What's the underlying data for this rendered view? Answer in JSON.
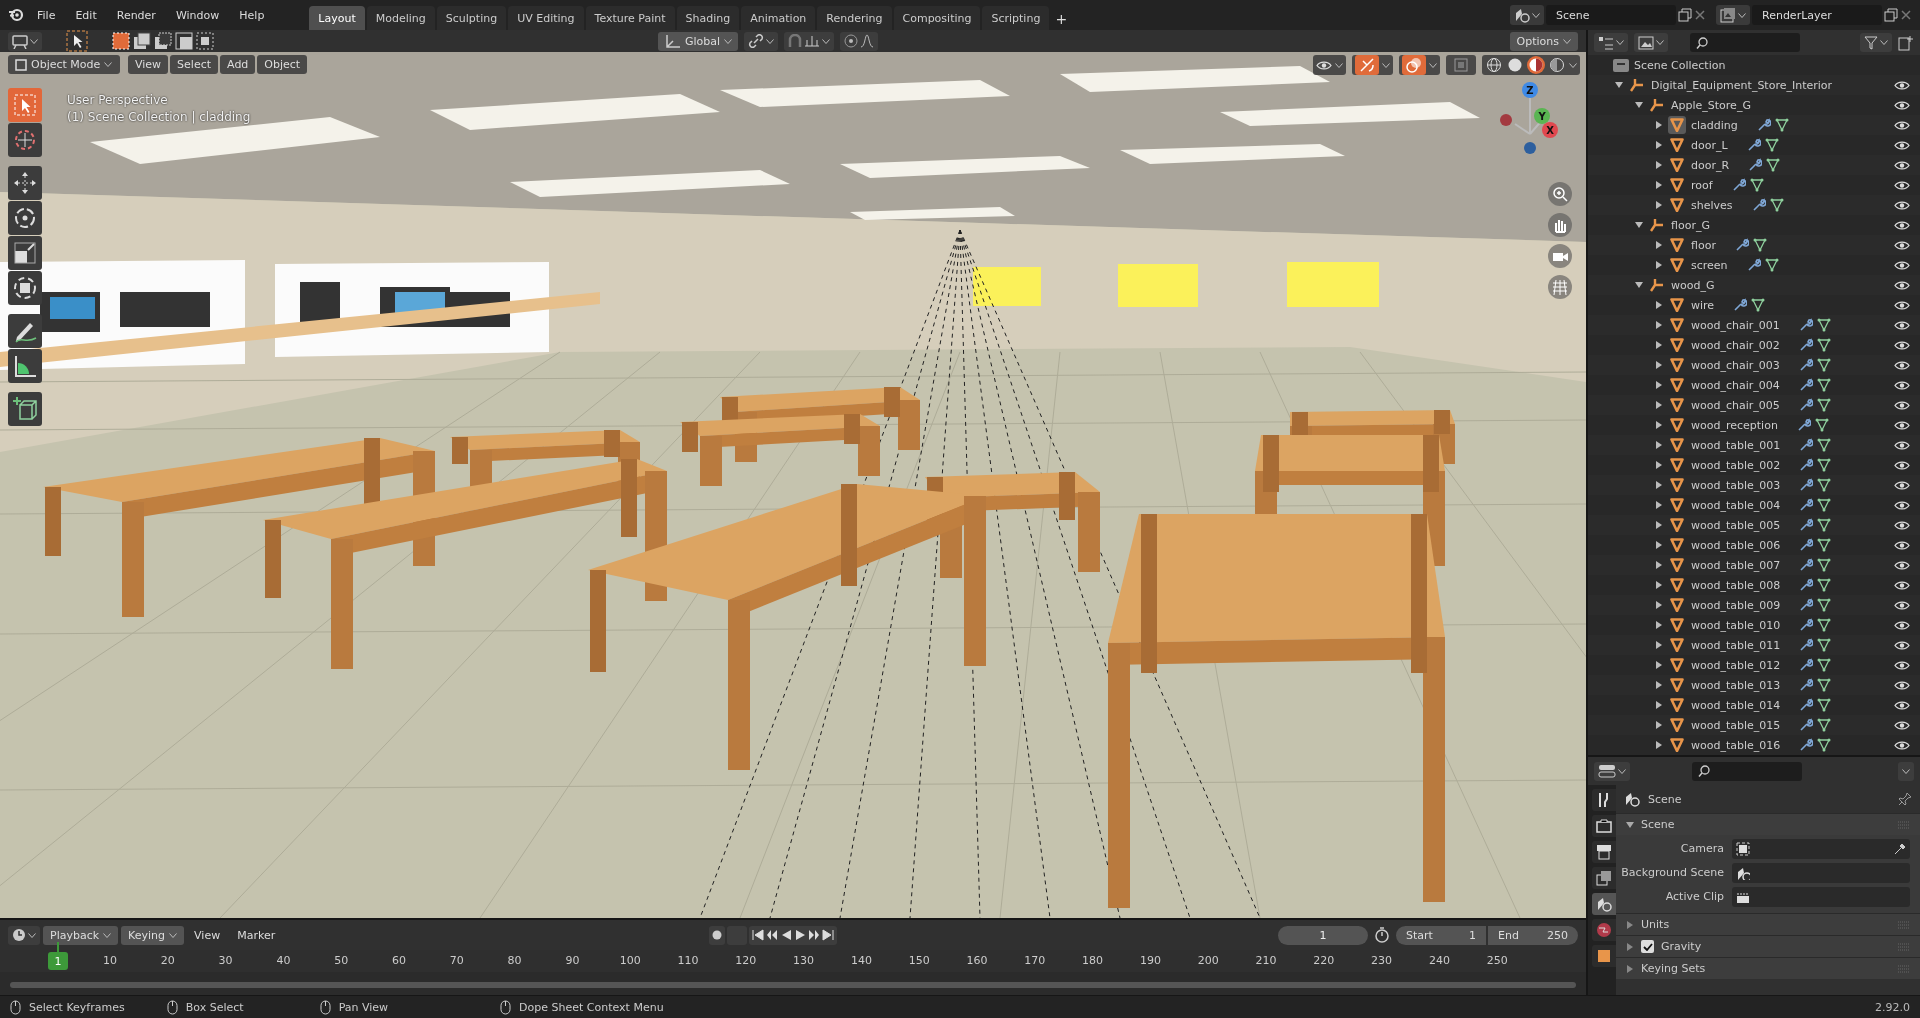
{
  "menus": [
    "File",
    "Edit",
    "Render",
    "Window",
    "Help"
  ],
  "workspace_tabs": [
    {
      "label": "Layout",
      "selected": true
    },
    {
      "label": "Modeling",
      "selected": false
    },
    {
      "label": "Sculpting",
      "selected": false
    },
    {
      "label": "UV Editing",
      "selected": false
    },
    {
      "label": "Texture Paint",
      "selected": false
    },
    {
      "label": "Shading",
      "selected": false
    },
    {
      "label": "Animation",
      "selected": false
    },
    {
      "label": "Rendering",
      "selected": false
    },
    {
      "label": "Compositing",
      "selected": false
    },
    {
      "label": "Scripting",
      "selected": false
    }
  ],
  "add_tab": "+",
  "scene": "Scene",
  "view_layer": "RenderLayer",
  "tool_header": {
    "selection_modes": [
      {
        "kind": "set",
        "selected": true
      },
      {
        "kind": "extend",
        "selected": false
      },
      {
        "kind": "subtract",
        "selected": false
      },
      {
        "kind": "invert",
        "selected": false
      },
      {
        "kind": "intersect",
        "selected": false
      }
    ],
    "orientation": "Global",
    "options": "Options"
  },
  "viewport": {
    "mode": "Object Mode",
    "menus": [
      "View",
      "Select",
      "Add",
      "Object"
    ],
    "view_name": "User Perspective",
    "context": "(1) Scene Collection | cladding",
    "toggles": [
      {
        "kind": "gizmos",
        "on": true
      },
      {
        "kind": "overlays",
        "on": true
      },
      {
        "kind": "xray",
        "on": false
      }
    ],
    "shading": [
      {
        "kind": "wireframe",
        "selected": false
      },
      {
        "kind": "solid",
        "selected": false
      },
      {
        "kind": "material",
        "selected": true
      },
      {
        "kind": "rendered",
        "selected": false
      }
    ],
    "tools": [
      {
        "kind": "select",
        "selected": true
      },
      {
        "kind": "cursor",
        "selected": false
      },
      {
        "kind": "move",
        "selected": false
      },
      {
        "kind": "rotate",
        "selected": false
      },
      {
        "kind": "scale",
        "selected": false
      },
      {
        "kind": "transform",
        "selected": false
      },
      {
        "kind": "annotate",
        "selected": false
      },
      {
        "kind": "measure",
        "selected": false
      },
      {
        "kind": "add-cube",
        "selected": false
      }
    ],
    "axes": [
      "Z",
      "Y",
      "X"
    ]
  },
  "outliner": {
    "root": "Scene Collection",
    "tree": [
      {
        "name": "Digital_Equipment_Store_Interior",
        "kind": "collection",
        "expanded": true,
        "selected": false,
        "children": [
          {
            "name": "Apple_Store_G",
            "kind": "collection",
            "expanded": true,
            "selected": false,
            "children": [
              {
                "name": "cladding",
                "kind": "mesh",
                "expanded": false,
                "selected": true
              },
              {
                "name": "door_L",
                "kind": "mesh",
                "expanded": false,
                "selected": false
              },
              {
                "name": "door_R",
                "kind": "mesh",
                "expanded": false,
                "selected": false
              },
              {
                "name": "roof",
                "kind": "mesh",
                "expanded": false,
                "selected": false
              },
              {
                "name": "shelves",
                "kind": "mesh",
                "expanded": false,
                "selected": false
              }
            ]
          },
          {
            "name": "floor_G",
            "kind": "collection",
            "expanded": true,
            "selected": false,
            "children": [
              {
                "name": "floor",
                "kind": "mesh",
                "expanded": false,
                "selected": false
              },
              {
                "name": "screen",
                "kind": "mesh",
                "expanded": false,
                "selected": false
              }
            ]
          },
          {
            "name": "wood_G",
            "kind": "collection",
            "expanded": true,
            "selected": false,
            "children": [
              {
                "name": "wire",
                "kind": "mesh",
                "expanded": false,
                "selected": false
              },
              {
                "name": "wood_chair_001",
                "kind": "mesh",
                "expanded": false,
                "selected": false
              },
              {
                "name": "wood_chair_002",
                "kind": "mesh",
                "expanded": false,
                "selected": false
              },
              {
                "name": "wood_chair_003",
                "kind": "mesh",
                "expanded": false,
                "selected": false
              },
              {
                "name": "wood_chair_004",
                "kind": "mesh",
                "expanded": false,
                "selected": false
              },
              {
                "name": "wood_chair_005",
                "kind": "mesh",
                "expanded": false,
                "selected": false
              },
              {
                "name": "wood_reception",
                "kind": "mesh",
                "expanded": false,
                "selected": false
              },
              {
                "name": "wood_table_001",
                "kind": "mesh",
                "expanded": false,
                "selected": false
              },
              {
                "name": "wood_table_002",
                "kind": "mesh",
                "expanded": false,
                "selected": false
              },
              {
                "name": "wood_table_003",
                "kind": "mesh",
                "expanded": false,
                "selected": false
              },
              {
                "name": "wood_table_004",
                "kind": "mesh",
                "expanded": false,
                "selected": false
              },
              {
                "name": "wood_table_005",
                "kind": "mesh",
                "expanded": false,
                "selected": false
              },
              {
                "name": "wood_table_006",
                "kind": "mesh",
                "expanded": false,
                "selected": false
              },
              {
                "name": "wood_table_007",
                "kind": "mesh",
                "expanded": false,
                "selected": false
              },
              {
                "name": "wood_table_008",
                "kind": "mesh",
                "expanded": false,
                "selected": false
              },
              {
                "name": "wood_table_009",
                "kind": "mesh",
                "expanded": false,
                "selected": false
              },
              {
                "name": "wood_table_010",
                "kind": "mesh",
                "expanded": false,
                "selected": false
              },
              {
                "name": "wood_table_011",
                "kind": "mesh",
                "expanded": false,
                "selected": false
              },
              {
                "name": "wood_table_012",
                "kind": "mesh",
                "expanded": false,
                "selected": false
              },
              {
                "name": "wood_table_013",
                "kind": "mesh",
                "expanded": false,
                "selected": false
              },
              {
                "name": "wood_table_014",
                "kind": "mesh",
                "expanded": false,
                "selected": false
              },
              {
                "name": "wood_table_015",
                "kind": "mesh",
                "expanded": false,
                "selected": false
              },
              {
                "name": "wood_table_016",
                "kind": "mesh",
                "expanded": false,
                "selected": false
              }
            ]
          }
        ]
      }
    ]
  },
  "properties": {
    "tabs": [
      {
        "kind": "tool",
        "selected": false
      },
      {
        "kind": "render",
        "selected": false
      },
      {
        "kind": "output",
        "selected": false
      },
      {
        "kind": "view-layer",
        "selected": false
      },
      {
        "kind": "scene",
        "selected": true
      },
      {
        "kind": "world",
        "selected": false
      },
      {
        "kind": "object",
        "selected": false
      }
    ],
    "context": "Scene",
    "panels": [
      {
        "kind": "panel",
        "title": "Scene",
        "expanded": true,
        "fields": [
          {
            "label": "Camera",
            "kind": "camera"
          },
          {
            "label": "Background Scene",
            "kind": "scene"
          },
          {
            "label": "Active Clip",
            "kind": "clip"
          }
        ]
      },
      {
        "kind": "panel",
        "title": "Units",
        "expanded": false
      },
      {
        "kind": "checkbox",
        "title": "Gravity",
        "expanded": false,
        "checked": true
      },
      {
        "kind": "panel",
        "title": "Keying Sets",
        "expanded": false
      }
    ]
  },
  "timeline": {
    "menus": [
      {
        "label": "Playback",
        "dropdown": true
      },
      {
        "label": "Keying",
        "dropdown": true
      },
      {
        "label": "View",
        "dropdown": false
      },
      {
        "label": "Marker",
        "dropdown": false
      }
    ],
    "current_frame": "1",
    "start_label": "Start",
    "start": "1",
    "end_label": "End",
    "end": "250",
    "playhead": "1",
    "ruler": [
      "10",
      "20",
      "30",
      "40",
      "50",
      "60",
      "70",
      "80",
      "90",
      "100",
      "110",
      "120",
      "130",
      "140",
      "150",
      "160",
      "170",
      "180",
      "190",
      "200",
      "210",
      "220",
      "230",
      "240",
      "250"
    ]
  },
  "status_bar": {
    "hints": [
      "Select Keyframes",
      "Box Select",
      "Pan View",
      "Dope Sheet Context Menu"
    ],
    "version": "2.92.0"
  }
}
